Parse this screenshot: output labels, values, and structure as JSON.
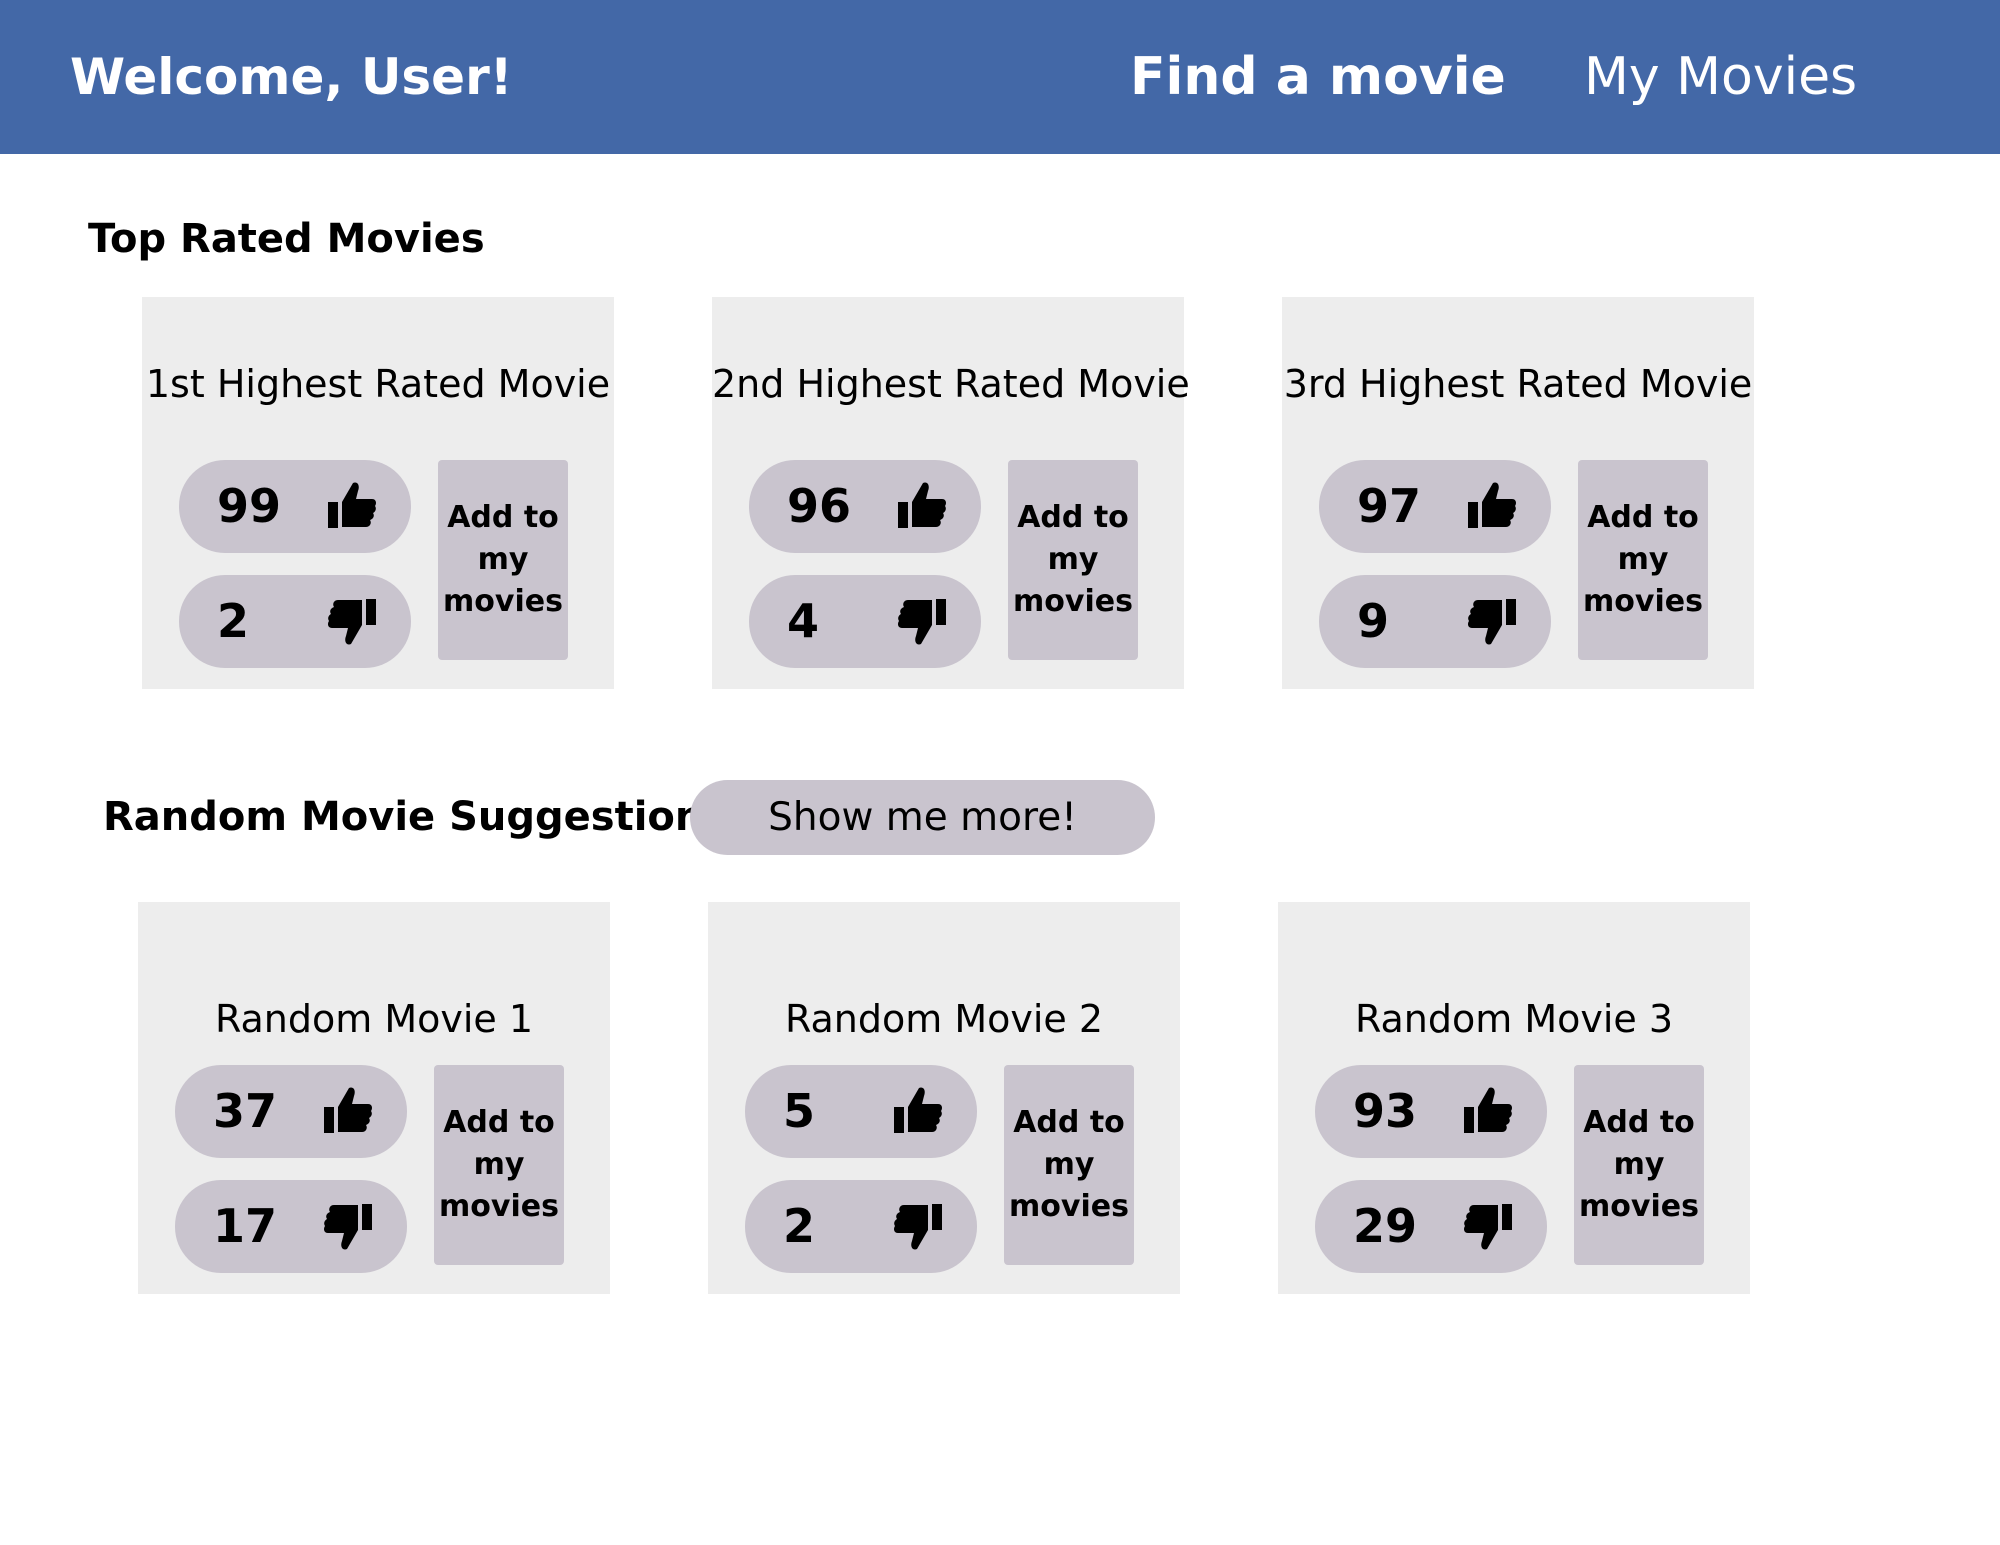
{
  "header": {
    "welcome": "Welcome, User!",
    "nav_find": "Find a movie",
    "nav_my": "My Movies"
  },
  "colors": {
    "header_bg": "#4368a7",
    "card_bg": "#ededed",
    "pill_bg": "#c9c4ce"
  },
  "top_rated": {
    "title": "Top Rated Movies",
    "movies": [
      {
        "title": "1st Highest Rated Movie",
        "likes": "99",
        "dislikes": "2",
        "add_label": "Add to my movies"
      },
      {
        "title": "2nd Highest Rated Movie",
        "likes": "96",
        "dislikes": "4",
        "add_label": "Add to my movies"
      },
      {
        "title": "3rd Highest Rated Movie",
        "likes": "97",
        "dislikes": "9",
        "add_label": "Add to my movies"
      }
    ]
  },
  "random": {
    "title": "Random Movie Suggestions",
    "more_button": "Show me more!",
    "movies": [
      {
        "title": "Random Movie 1",
        "likes": "37",
        "dislikes": "17",
        "add_label": "Add to my movies"
      },
      {
        "title": "Random Movie 2",
        "likes": "5",
        "dislikes": "2",
        "add_label": "Add to my movies"
      },
      {
        "title": "Random Movie 3",
        "likes": "93",
        "dislikes": "29",
        "add_label": "Add to my movies"
      }
    ]
  },
  "icons": {
    "like": "thumbs-up-icon",
    "dislike": "thumbs-down-icon"
  }
}
